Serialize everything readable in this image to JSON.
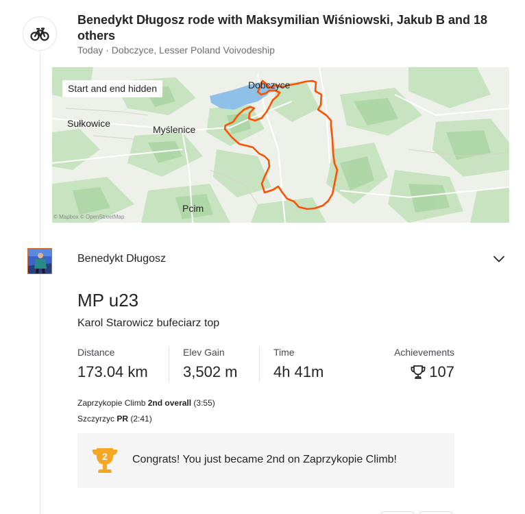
{
  "header": {
    "title": "Benedykt Długosz rode with Maksymilian Wiśniowski, Jakub B and 18 others",
    "subtitle": "Today · Dobczyce, Lesser Poland Voivodeship"
  },
  "map": {
    "badge": "Start and end hidden",
    "labels": [
      "Sułkowice",
      "Myślenice",
      "Dobczyce",
      "Pcim"
    ],
    "attribution": "© Mapbox © OpenStreetMap",
    "route_color": "#fc5200"
  },
  "athlete": {
    "name": "Benedykt Długosz"
  },
  "activity": {
    "title": "MP u23",
    "description": "Karol Starowicz bufeciarz top"
  },
  "stats": [
    {
      "label": "Distance",
      "value": "173.04 km"
    },
    {
      "label": "Elev Gain",
      "value": "3,502 m"
    },
    {
      "label": "Time",
      "value": "4h 41m"
    }
  ],
  "achievements": {
    "label": "Achievements",
    "value": "107"
  },
  "segments": [
    {
      "name": "Zaprzykopie Climb",
      "result": "2nd overall",
      "time": "(3:55)"
    },
    {
      "name": "Szczyrzyc",
      "result": "PR",
      "time": "(2:41)"
    }
  ],
  "congrats": {
    "rank": "2",
    "text": "Congrats! You just became 2nd on Zaprzykopie Climb!"
  },
  "colors": {
    "accent": "#fc5200",
    "gold": "#f5a623",
    "text": "#242428",
    "muted": "#6d6d78"
  }
}
